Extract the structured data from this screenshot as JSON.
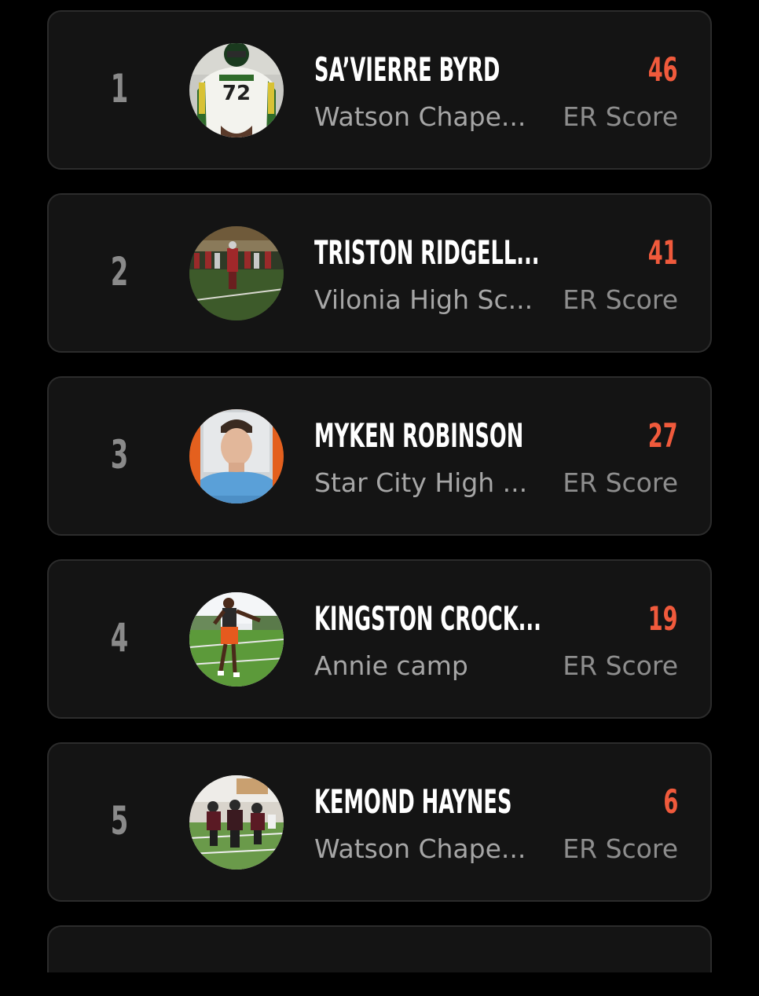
{
  "leaderboard": {
    "score_label": "ER Score",
    "accent_color": "#f05a3c",
    "entries": [
      {
        "rank": "1",
        "name": "SA’VIERRE BYRD",
        "school": "Watson Chape...",
        "score": "46",
        "avatar": "player-wildcats-72-photo"
      },
      {
        "rank": "2",
        "name": "TRISTON RIDGELL...",
        "school": "Vilonia High Sc...",
        "score": "41",
        "avatar": "football-field-photo"
      },
      {
        "rank": "3",
        "name": "MYKEN ROBINSON",
        "school": "Star City High ...",
        "score": "27",
        "avatar": "portrait-earned-not-given-photo"
      },
      {
        "rank": "4",
        "name": "KINGSTON CROCK...",
        "school": "Annie camp",
        "score": "19",
        "avatar": "athlete-on-field-photo"
      },
      {
        "rank": "5",
        "name": "KEMOND HAYNES",
        "school": "Watson Chape...",
        "score": "6",
        "avatar": "team-practice-photo"
      }
    ]
  }
}
